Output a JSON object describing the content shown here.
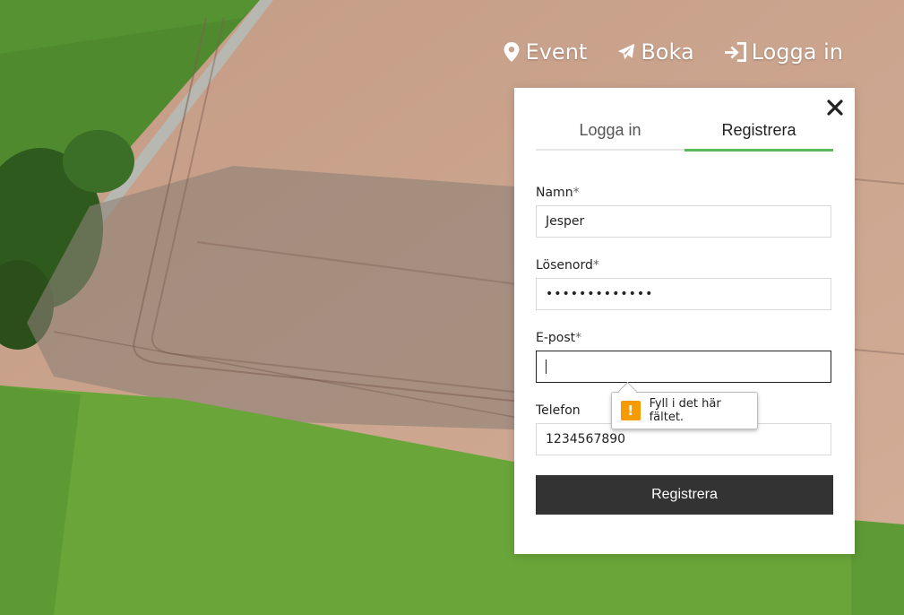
{
  "nav": {
    "items": [
      {
        "label": "Event",
        "icon": "map-marker-icon"
      },
      {
        "label": "Boka",
        "icon": "paper-plane-icon"
      },
      {
        "label": "Logga in",
        "icon": "sign-in-icon"
      }
    ]
  },
  "modal": {
    "tabs": [
      {
        "label": "Logga in",
        "active": false
      },
      {
        "label": "Registrera",
        "active": true
      }
    ],
    "fields": {
      "name": {
        "label": "Namn",
        "required_mark": "*",
        "value": "Jesper"
      },
      "password": {
        "label": "Lösenord",
        "required_mark": "*",
        "value": "•••••••••••••"
      },
      "email": {
        "label": "E-post",
        "required_mark": "*",
        "value": ""
      },
      "phone": {
        "label": "Telefon",
        "value": "1234567890"
      }
    },
    "submit_label": "Registrera"
  },
  "validation": {
    "message": "Fyll i det här fältet.",
    "icon": "!"
  },
  "colors": {
    "accent_tab": "#5cb85c",
    "button_bg": "#333333",
    "warning": "#f59a00"
  }
}
